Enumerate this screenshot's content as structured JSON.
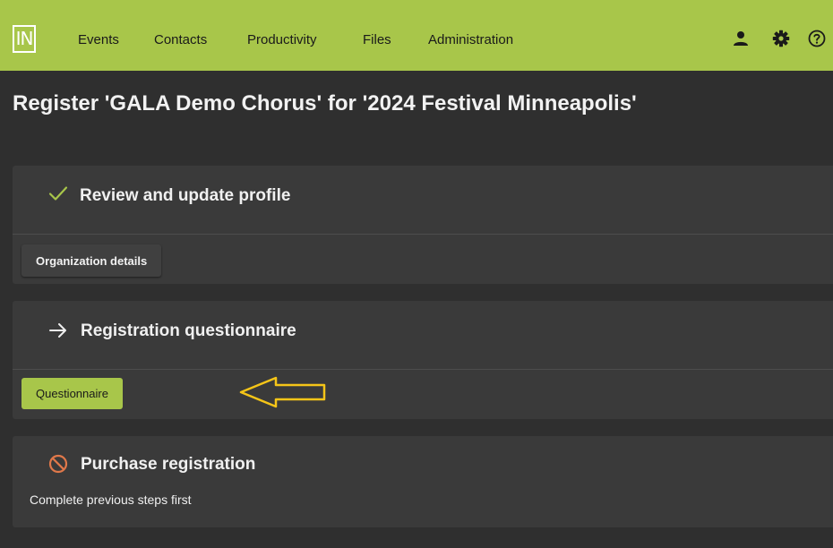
{
  "app": {
    "logo_text": "IN",
    "brand_color": "#a8c64a"
  },
  "nav": {
    "items": [
      {
        "label": "Events"
      },
      {
        "label": "Contacts"
      },
      {
        "label": "Productivity"
      },
      {
        "label": "Files"
      },
      {
        "label": "Administration"
      }
    ],
    "icons": [
      "person-icon",
      "gear-icon",
      "help-icon"
    ]
  },
  "page": {
    "title": "Register 'GALA Demo Chorus' for '2024 Festival Minneapolis'"
  },
  "steps": [
    {
      "status": "complete",
      "status_icon": "checkmark-icon",
      "title": "Review and update profile",
      "button_label": "Organization details"
    },
    {
      "status": "current",
      "status_icon": "arrow-right-icon",
      "title": "Registration questionnaire",
      "button_label": "Questionnaire",
      "annotation": "arrow-left-annotation"
    },
    {
      "status": "blocked",
      "status_icon": "prohibited-icon",
      "title": "Purchase registration",
      "note": "Complete previous steps first"
    }
  ],
  "colors": {
    "complete": "#a8c64a",
    "blocked": "#e0784a",
    "annotation": "#f5c518"
  }
}
